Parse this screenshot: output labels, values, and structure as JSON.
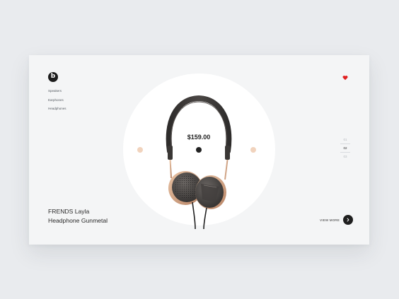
{
  "brand": {
    "logo_letter": "b"
  },
  "nav": {
    "items": [
      {
        "label": "Speakers"
      },
      {
        "label": "Earphones"
      },
      {
        "label": "Headphones"
      }
    ]
  },
  "wishlist": {
    "icon": "heart-icon",
    "color": "#e02020"
  },
  "product": {
    "price": "$159.00",
    "name_line1": "FRENDS Layla",
    "name_line2": "Headphone Gunmetal"
  },
  "pagination": {
    "pages": [
      "01",
      "02",
      "03"
    ],
    "active": "02"
  },
  "cta": {
    "label": "VIEW MORE",
    "icon": "chevron-right-icon"
  },
  "colors": {
    "accent_dot": "#f1d3bd",
    "dark": "#1f1f1f",
    "card": "#f4f5f6",
    "background": "#e9ebee"
  }
}
